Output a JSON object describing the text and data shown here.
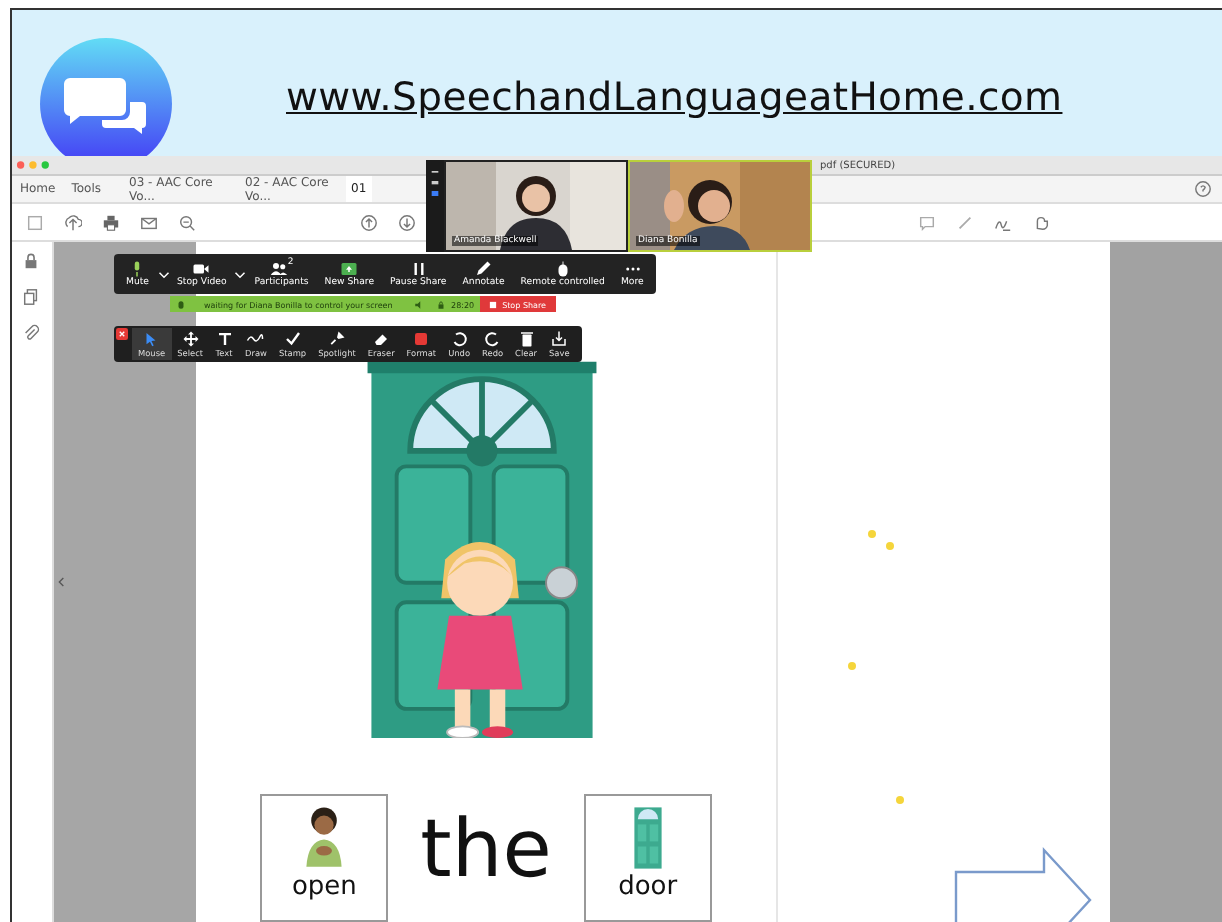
{
  "header": {
    "url": "www.SpeechandLanguageatHome.com"
  },
  "window": {
    "title": "pdf (SECURED)"
  },
  "tabs": [
    {
      "label": "Home",
      "selected": false
    },
    {
      "label": "Tools",
      "selected": false
    },
    {
      "label": "03 - AAC Core Vo...",
      "selected": false
    },
    {
      "label": "02 - AAC Core Vo...",
      "selected": false
    },
    {
      "label": "01",
      "selected": true
    }
  ],
  "video_tiles": [
    {
      "name": "Amanda Blackwell",
      "speaking": false
    },
    {
      "name": "Diana Bonilla",
      "speaking": true
    }
  ],
  "meeting_toolbar": [
    {
      "kind": "mic",
      "label": "Mute",
      "menu": true
    },
    {
      "kind": "video",
      "label": "Stop Video",
      "menu": true
    },
    {
      "kind": "participants",
      "label": "Participants",
      "count": "2",
      "menu": false
    },
    {
      "kind": "share",
      "label": "New Share",
      "menu": false
    },
    {
      "kind": "pause",
      "label": "Pause Share",
      "menu": false
    },
    {
      "kind": "annotate",
      "label": "Annotate",
      "menu": false
    },
    {
      "kind": "remote",
      "label": "Remote controlled",
      "menu": false
    },
    {
      "kind": "more",
      "label": "More",
      "menu": false
    }
  ],
  "remote_control_bar": {
    "message": "waiting for Diana Bonilla to control your screen",
    "timer": "28:20",
    "stop_button": "Stop Share"
  },
  "annotation_toolbar": [
    {
      "kind": "mouse",
      "label": "Mouse",
      "selected": true
    },
    {
      "kind": "select",
      "label": "Select",
      "selected": false
    },
    {
      "kind": "text",
      "label": "Text",
      "selected": false
    },
    {
      "kind": "draw",
      "label": "Draw",
      "selected": false
    },
    {
      "kind": "stamp",
      "label": "Stamp",
      "selected": false
    },
    {
      "kind": "spotlight",
      "label": "Spotlight",
      "selected": false
    },
    {
      "kind": "eraser",
      "label": "Eraser",
      "selected": false
    },
    {
      "kind": "format",
      "label": "Format",
      "selected": false
    },
    {
      "kind": "undo",
      "label": "Undo",
      "selected": false
    },
    {
      "kind": "redo",
      "label": "Redo",
      "selected": false
    },
    {
      "kind": "clear",
      "label": "Clear",
      "selected": false
    },
    {
      "kind": "save",
      "label": "Save",
      "selected": false
    }
  ],
  "sentence": [
    {
      "kind": "person_card",
      "label": "open"
    },
    {
      "kind": "word",
      "label": "the"
    },
    {
      "kind": "door_card",
      "label": "door"
    }
  ]
}
